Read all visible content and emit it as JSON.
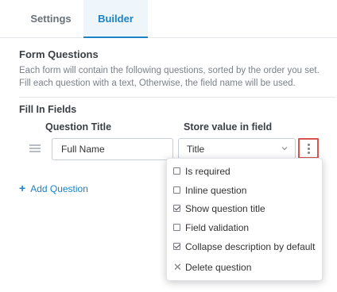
{
  "tabs": [
    {
      "label": "Settings",
      "active": false
    },
    {
      "label": "Builder",
      "active": true
    }
  ],
  "form_questions": {
    "title": "Form Questions",
    "description": "Each form will contain the following questions, sorted by the order you set. Fill each question with a text, Otherwise, the field name will be used."
  },
  "fill_in_fields": {
    "title": "Fill In Fields",
    "col_question_title": "Question Title",
    "col_store_value": "Store value in field",
    "row": {
      "question_title_value": "Full Name",
      "store_field_value": "Title"
    },
    "add_question_label": "Add Question"
  },
  "menu": {
    "items": [
      {
        "label": "Is required",
        "type": "checkbox",
        "checked": false
      },
      {
        "label": "Inline question",
        "type": "checkbox",
        "checked": false
      },
      {
        "label": "Show question title",
        "type": "checkbox",
        "checked": true
      },
      {
        "label": "Field validation",
        "type": "checkbox",
        "checked": false
      },
      {
        "label": "Collapse description by default",
        "type": "checkbox",
        "checked": true
      },
      {
        "label": "Delete question",
        "type": "action",
        "icon": "close-icon"
      }
    ]
  },
  "colors": {
    "accent": "#1d82c4",
    "highlight_border": "#d9534f"
  }
}
